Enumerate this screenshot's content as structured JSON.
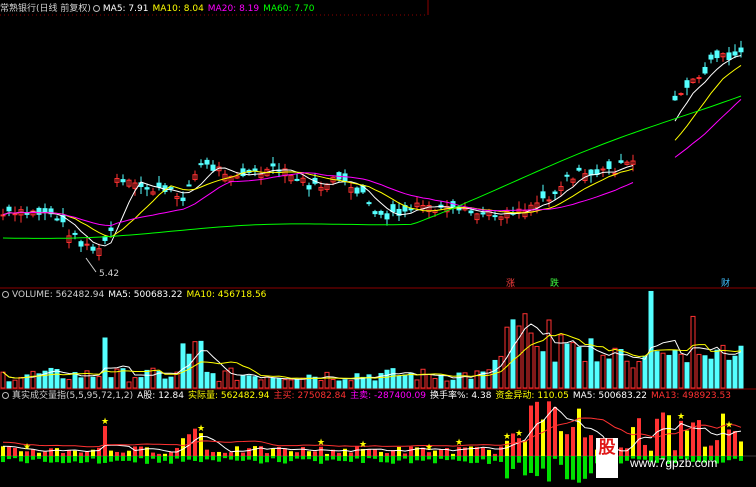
{
  "main_header": {
    "title": "常熟银行(日线 前复权)",
    "ma5": "MA5: 7.91",
    "ma10": "MA10: 8.04",
    "ma20": "MA20: 8.19",
    "ma60": "MA60: 7.70"
  },
  "main_labels": {
    "low_price": "5.42",
    "marker_zhang": "涨",
    "marker_die": "跌",
    "marker_cai": "财"
  },
  "volume_header": {
    "title": "VOLUME: 562482.94",
    "ma5": "MA5: 500683.22",
    "ma10": "MA10: 456718.56"
  },
  "indicator_header": {
    "title": "真实成交量指(5,5,95,72,1,2)",
    "a_share": "A股: 12.84",
    "actual_volume": "实际量: 562482.94",
    "main_buy": "主买: 275082.84",
    "main_sell": "主卖: -287400.09",
    "turnover": "换手率%: 4.38",
    "capital_move": "资金异动: 110.05",
    "ma5": "MA5: 500683.22",
    "ma13": "MA13: 498923.53"
  },
  "watermark": {
    "logo_text": "股",
    "url": "www.7gpzb.com"
  },
  "colors": {
    "up": "#ff3232",
    "down": "#54ffff",
    "ma5": "#ffffff",
    "ma10": "#ffff00",
    "ma20": "#ff00ff",
    "ma60": "#00ff00",
    "separator": "#8b0000"
  }
}
